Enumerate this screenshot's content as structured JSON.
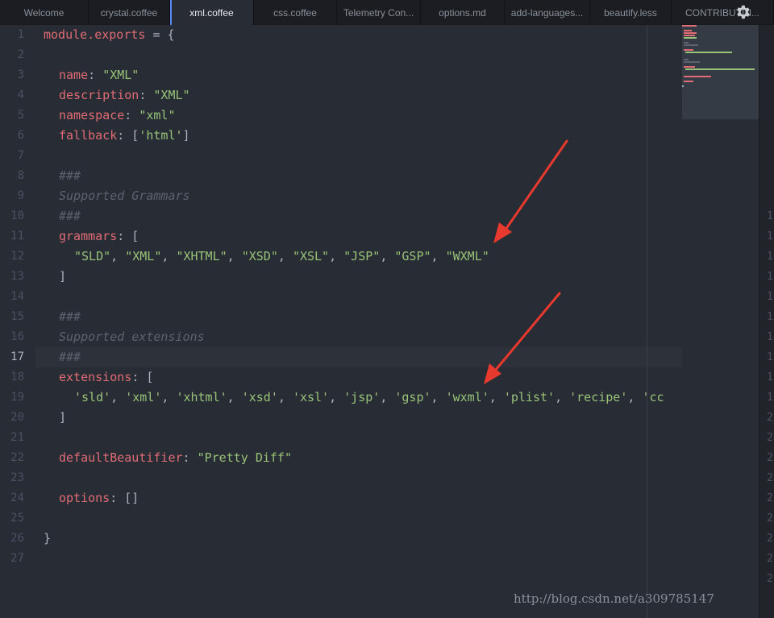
{
  "tabs": [
    {
      "label": "Welcome",
      "active": false
    },
    {
      "label": "crystal.coffee",
      "active": false
    },
    {
      "label": "xml.coffee",
      "active": true
    },
    {
      "label": "css.coffee",
      "active": false
    },
    {
      "label": "Telemetry Con...",
      "active": false
    },
    {
      "label": "options.md",
      "active": false
    },
    {
      "label": "add-languages...",
      "active": false
    },
    {
      "label": "beautify.less",
      "active": false
    },
    {
      "label": "CONTRIBUTIN...",
      "active": false
    }
  ],
  "editor": {
    "current_line": "17",
    "line_numbers": [
      "1",
      "2",
      "3",
      "4",
      "5",
      "6",
      "7",
      "8",
      "9",
      "10",
      "11",
      "12",
      "13",
      "14",
      "15",
      "16",
      "17",
      "18",
      "19",
      "20",
      "21",
      "22",
      "23",
      "24",
      "25",
      "26",
      "27"
    ],
    "code": {
      "l1_a": "module.exports",
      "l1_b": " = {",
      "l3_k": "name",
      "l3_p": ": ",
      "l3_s": "\"XML\"",
      "l4_k": "description",
      "l4_p": ": ",
      "l4_s": "\"XML\"",
      "l5_k": "namespace",
      "l5_p": ": ",
      "l5_s": "\"xml\"",
      "l6_k": "fallback",
      "l6_p": ": [",
      "l6_s": "'html'",
      "l6_e": "]",
      "l8": "###",
      "l9": "Supported Grammars",
      "l10": "###",
      "l11_k": "grammars",
      "l11_p": ": [",
      "l12": [
        "\"SLD\"",
        "\"XML\"",
        "\"XHTML\"",
        "\"XSD\"",
        "\"XSL\"",
        "\"JSP\"",
        "\"GSP\"",
        "\"WXML\""
      ],
      "l13": "]",
      "l15": "###",
      "l16": "Supported extensions",
      "l17": "###",
      "l18_k": "extensions",
      "l18_p": ": [",
      "l19": [
        "'sld'",
        "'xml'",
        "'xhtml'",
        "'xsd'",
        "'xsl'",
        "'jsp'",
        "'gsp'",
        "'wxml'",
        "'plist'",
        "'recipe'",
        "'cc"
      ],
      "l20": "]",
      "l22_k": "defaultBeautifier",
      "l22_p": ": ",
      "l22_s": "\"Pretty Diff\"",
      "l24_k": "options",
      "l24_p": ": []",
      "l26": "}"
    }
  },
  "right_panel_digits": [
    "1",
    "1",
    "1",
    "1",
    "1",
    "1",
    "1",
    "1",
    "1",
    "1",
    "2",
    "2",
    "2",
    "2",
    "2",
    "2",
    "2",
    "2",
    "2",
    "2",
    "2",
    "2",
    "2",
    "2",
    "2",
    "2",
    "2"
  ],
  "watermark": "http://blog.csdn.net/a309785147",
  "colors": {
    "keyword": "#e06c75",
    "string": "#98c379",
    "comment": "#5c6370",
    "arrow": "#e8392f",
    "tab_accent": "#568af2"
  },
  "icons": {
    "settings": "gear-icon",
    "annotation": "red-arrow"
  }
}
